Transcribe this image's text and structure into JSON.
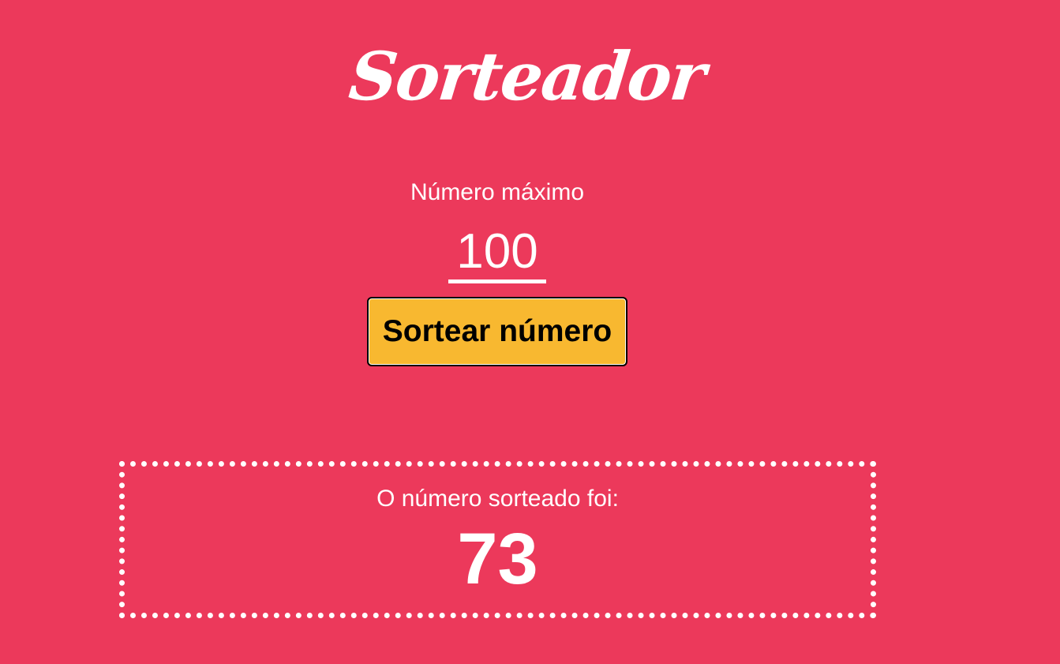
{
  "app": {
    "logo_text": "Sorteador"
  },
  "form": {
    "max_label": "Número máximo",
    "max_value": "100",
    "draw_button_label": "Sortear número"
  },
  "result": {
    "label": "O número sorteado foi:",
    "value": "73"
  },
  "colors": {
    "background": "#EC395B",
    "button": "#F8B830",
    "text": "#FFFFFF"
  }
}
